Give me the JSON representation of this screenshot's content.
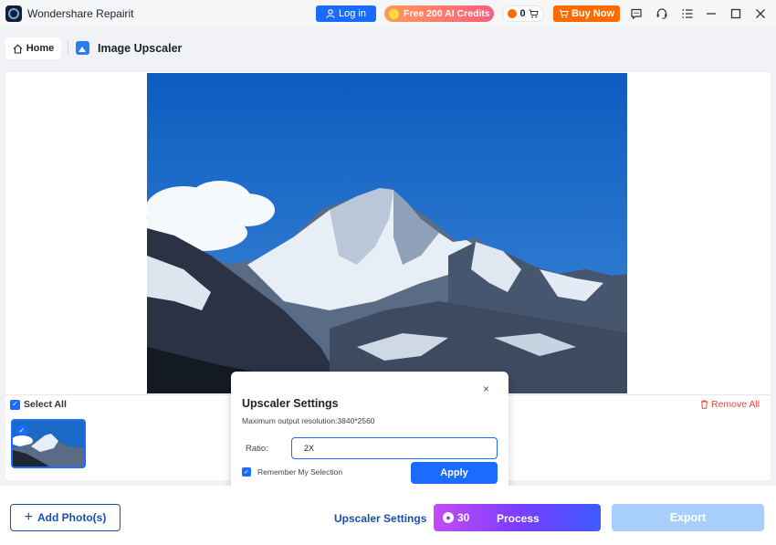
{
  "window": {
    "title": "Wondershare Repairit",
    "login_label": "Log in",
    "credits_label": "Free 200 AI Credits",
    "cart_count": "0",
    "buy_label": "Buy Now"
  },
  "nav": {
    "home_label": "Home",
    "page_title": "Image Upscaler"
  },
  "list": {
    "select_all_label": "Select All",
    "remove_all_label": "Remove All"
  },
  "popup": {
    "title": "Upscaler Settings",
    "subtitle": "Maximum output resolution:3840*2560",
    "ratio_label": "Ratio:",
    "ratio_value": "2X",
    "remember_label": "Remember My Selection",
    "apply_label": "Apply",
    "close_glyph": "×"
  },
  "bottom": {
    "add_label": "Add Photo(s)",
    "upscaler_settings_label": "Upscaler Settings",
    "process_cost": "30",
    "process_label": "Process",
    "export_label": "Export"
  },
  "colors": {
    "primary": "#1a6bff",
    "buy": "#ff6a00",
    "remove": "#e4463d",
    "export_disabled": "#a8cffb"
  }
}
